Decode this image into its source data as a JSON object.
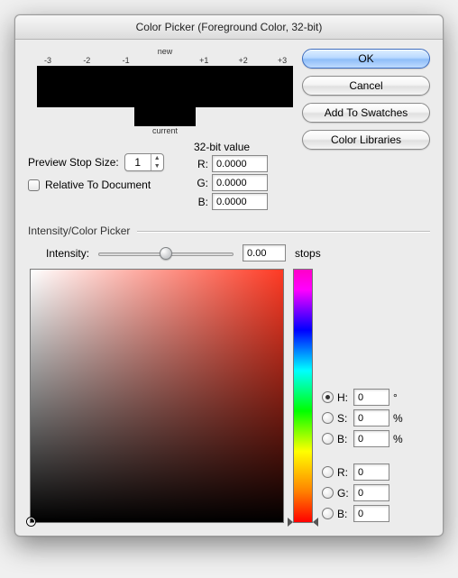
{
  "title": "Color Picker (Foreground Color, 32-bit)",
  "buttons": {
    "ok": "OK",
    "cancel": "Cancel",
    "add_swatches": "Add To Swatches",
    "color_libraries": "Color Libraries"
  },
  "preview": {
    "new_label": "new",
    "current_label": "current",
    "stops": [
      "-3",
      "-2",
      "-1",
      "",
      "+1",
      "+2",
      "+3"
    ]
  },
  "bit32": {
    "heading": "32-bit value",
    "r_label": "R:",
    "r": "0.0000",
    "g_label": "G:",
    "g": "0.0000",
    "b_label": "B:",
    "b": "0.0000"
  },
  "pss": {
    "label": "Preview Stop Size:",
    "value": "1"
  },
  "relative": {
    "label": "Relative To Document",
    "checked": false
  },
  "section": {
    "heading": "Intensity/Color Picker"
  },
  "intensity": {
    "label": "Intensity:",
    "value": "0.00",
    "unit": "stops"
  },
  "hsb": {
    "h_label": "H:",
    "h": "0",
    "h_unit": "°",
    "s_label": "S:",
    "s": "0",
    "s_unit": "%",
    "b_label": "B:",
    "b": "0",
    "b_unit": "%"
  },
  "rgb": {
    "r_label": "R:",
    "r": "0",
    "g_label": "G:",
    "g": "0",
    "b_label": "B:",
    "b": "0"
  }
}
